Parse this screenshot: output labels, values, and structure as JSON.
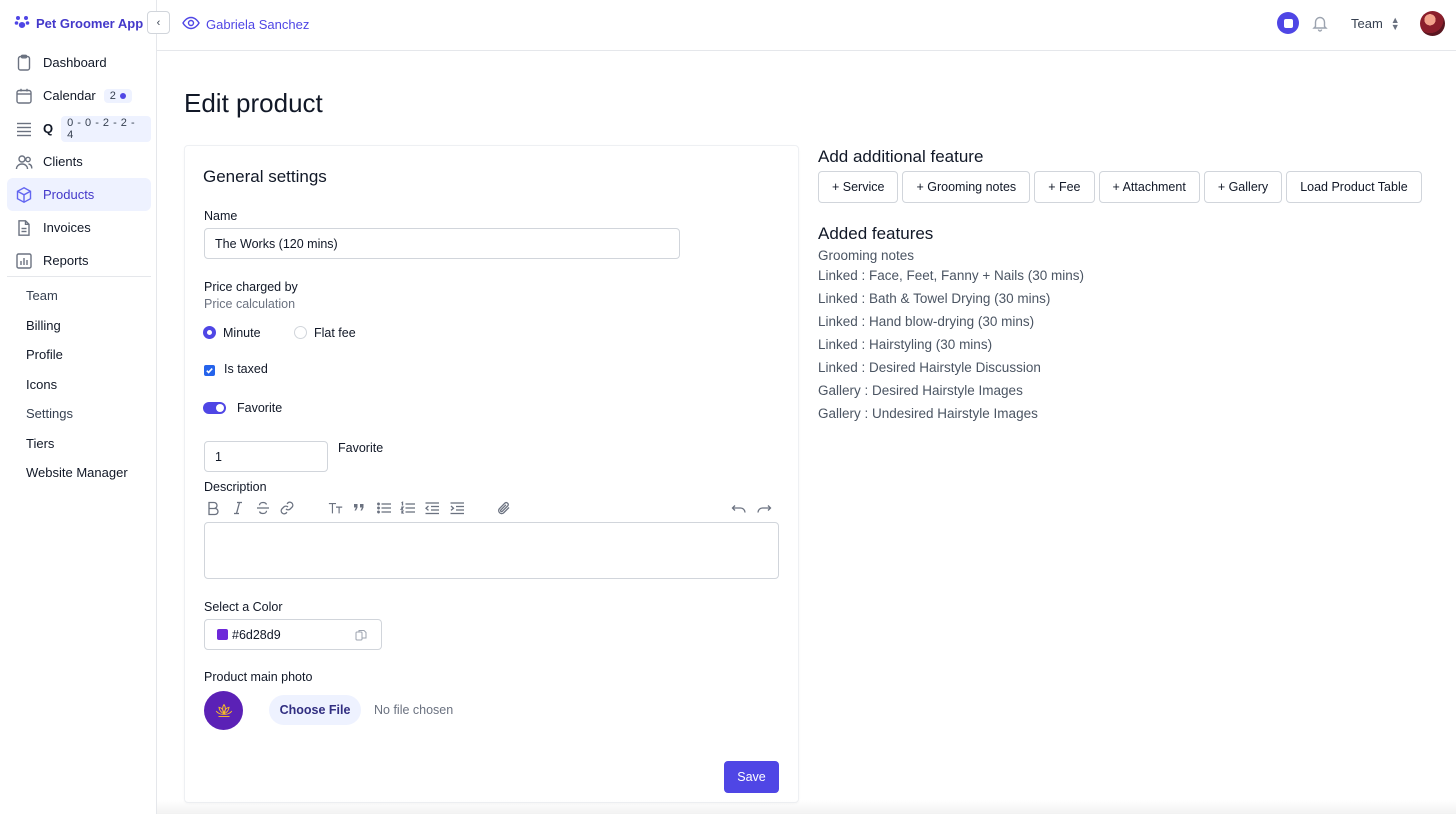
{
  "app": {
    "name": "Pet Groomer App"
  },
  "sidebar": {
    "items": [
      {
        "label": "Dashboard",
        "icon": "clipboard-icon"
      },
      {
        "label": "Calendar",
        "icon": "calendar-icon",
        "badge": "2"
      },
      {
        "label": "Q",
        "icon": "queue-icon",
        "badge": "0 - 0 - 2 - 2 - 4"
      },
      {
        "label": "Clients",
        "icon": "users-icon"
      },
      {
        "label": "Products",
        "icon": "box-icon",
        "active": true
      },
      {
        "label": "Invoices",
        "icon": "document-icon"
      },
      {
        "label": "Reports",
        "icon": "chart-icon"
      }
    ],
    "secondary": [
      "Team",
      "Billing",
      "Profile",
      "Icons",
      "Settings",
      "Tiers",
      "Website Manager"
    ]
  },
  "topbar": {
    "viewing_as": "Gabriela Sanchez",
    "team_label": "Team"
  },
  "page": {
    "title": "Edit product"
  },
  "general": {
    "title": "General settings",
    "name_label": "Name",
    "name_value": "The Works (120 mins)",
    "price_label": "Price charged by",
    "price_sublabel": "Price calculation",
    "price_options": [
      "Minute",
      "Flat fee"
    ],
    "price_selected": "Minute",
    "taxed_label": "Is taxed",
    "taxed": true,
    "favorite_toggle_label": "Favorite",
    "favorite_on": true,
    "favorite_value": "1",
    "favorite_field_label": "Favorite",
    "description_label": "Description",
    "color_label": "Select a Color",
    "color_value": "#6d28d9",
    "photo_label": "Product main photo",
    "choose_file_label": "Choose File",
    "no_file_text": "No file chosen",
    "save_label": "Save"
  },
  "features": {
    "add_title": "Add additional feature",
    "buttons": [
      "+ Service",
      "+ Grooming notes",
      "+ Fee",
      "+ Attachment",
      "+ Gallery",
      "Load Product Table"
    ],
    "added_title": "Added features",
    "added": [
      "Grooming notes",
      "Linked : Face, Feet, Fanny + Nails (30 mins)",
      "Linked : Bath & Towel Drying (30 mins)",
      "Linked : Hand blow-drying (30 mins)",
      "Linked : Hairstyling (30 mins)",
      "Linked : Desired Hairstyle Discussion",
      "Gallery : Desired Hairstyle Images",
      "Gallery : Undesired Hairstyle Images"
    ]
  },
  "colors": {
    "accent": "#4f46e5",
    "swatch": "#6d28d9",
    "photo_bg": "#5b21b6"
  }
}
